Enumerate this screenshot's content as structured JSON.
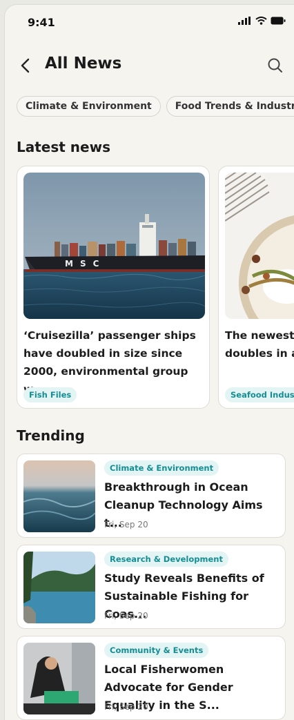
{
  "status": {
    "time": "9:41"
  },
  "header": {
    "title": "All News"
  },
  "chips": [
    "Climate & Environment",
    "Food Trends & Industry"
  ],
  "sections": {
    "latest": "Latest news",
    "trending": "Trending"
  },
  "latest": [
    {
      "title": "‘Cruisezilla’ passenger ships have doubled in size since 2000, environmental group w...",
      "tag": "Fish Files"
    },
    {
      "title": "The newest doubles in a",
      "tag": "Seafood Indust"
    }
  ],
  "trending": [
    {
      "tag": "Climate & Environment",
      "title": "Breakthrough in Ocean Cleanup Technology Aims t...",
      "date": "Fri, Sep 20"
    },
    {
      "tag": "Research & Development",
      "title": "Study Reveals Benefits of Sustainable Fishing for Coas...",
      "date": "Fri, Sep 20"
    },
    {
      "tag": "Community & Events",
      "title": "Local Fisherwomen Advocate for Gender Equality in the S...",
      "date": "Fri, Sep 20"
    }
  ],
  "ship_logo": "MSC"
}
